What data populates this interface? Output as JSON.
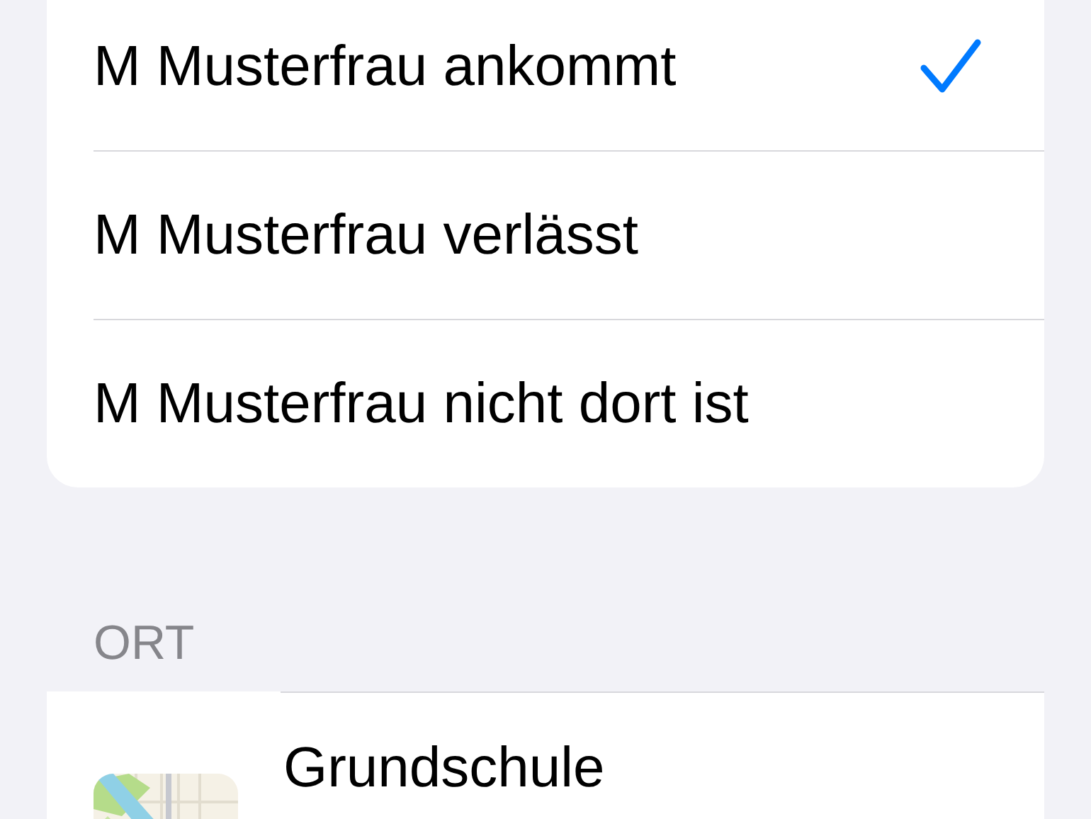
{
  "options": [
    {
      "label": "M Musterfrau ankommt",
      "selected": true
    },
    {
      "label": "M Musterfrau verlässt",
      "selected": false
    },
    {
      "label": "M Musterfrau nicht dort ist",
      "selected": false
    }
  ],
  "location_section": {
    "header": "ORT",
    "place": {
      "name": "Grundschule"
    }
  }
}
